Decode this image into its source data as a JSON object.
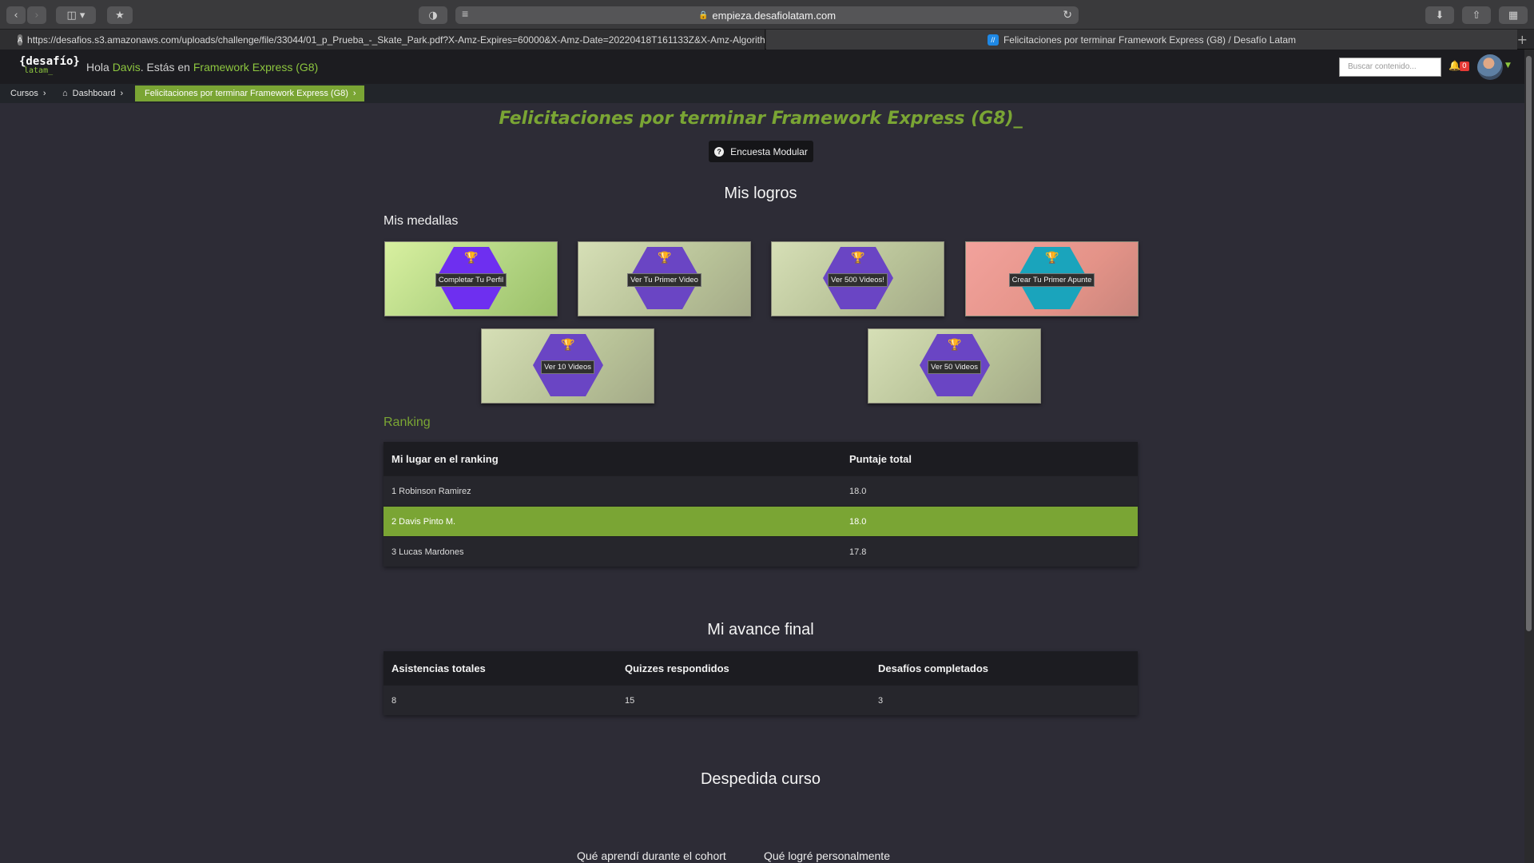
{
  "browser": {
    "url": "empieza.desafiolatam.com",
    "tabs": [
      {
        "label": "https://desafios.s3.amazonaws.com/uploads/challenge/file/33044/01_p_Prueba_-_Skate_Park.pdf?X-Amz-Expires=60000&X-Amz-Date=20220418T161133Z&X-Amz-Algorith...",
        "favicon": "A"
      },
      {
        "label": "Felicitaciones por terminar Framework Express (G8) / Desafío Latam",
        "favicon": "//"
      }
    ]
  },
  "header": {
    "logo_top": "{desafío}",
    "logo_bottom": "latam_",
    "greeting_prefix": "Hola",
    "user_name": "Davis",
    "greeting_middle": ". Estás en",
    "course_name": "Framework Express (G8)",
    "search_placeholder": "Buscar contenido...",
    "notification_count": "0"
  },
  "breadcrumb": [
    {
      "label": "Cursos"
    },
    {
      "label": "Dashboard"
    },
    {
      "label": "Felicitaciones por terminar Framework Express (G8)"
    }
  ],
  "main": {
    "title": "Felicitaciones por terminar Framework Express (G8)_",
    "survey_button": "Encuesta Modular",
    "achievements_title": "Mis logros",
    "medals_heading": "Mis medallas",
    "medals": [
      {
        "label": "Completar Tu Perfil",
        "color": "#6e2ff0"
      },
      {
        "label": "Ver Tu Primer Video",
        "color": "#6a45c4"
      },
      {
        "label": "Ver 500 Videos!",
        "color": "#6a45c4"
      },
      {
        "label": "Crear Tu Primer Apunte",
        "color": "#1aa4bc"
      },
      {
        "label": "Ver 10 Videos",
        "color": "#6a45c4"
      },
      {
        "label": "Ver 50 Videos",
        "color": "#6a45c4"
      }
    ],
    "ranking_heading": "Ranking",
    "ranking": {
      "headers": [
        "Mi lugar en el ranking",
        "Puntaje total"
      ],
      "rows": [
        {
          "place": "1 Robinson Ramirez",
          "score": "18.0"
        },
        {
          "place": "2 Davis Pinto M.",
          "score": "18.0"
        },
        {
          "place": "3 Lucas Mardones",
          "score": "17.8"
        }
      ]
    },
    "progress_title": "Mi avance final",
    "progress": {
      "headers": [
        "Asistencias totales",
        "Quizzes respondidos",
        "Desafíos completados"
      ],
      "values": [
        "8",
        "15",
        "3"
      ]
    },
    "farewell_title": "Despedida curso",
    "farewell_links": [
      "Qué aprendí durante el cohort",
      "Qué logré personalmente"
    ]
  },
  "colors": {
    "accent": "#7aa534",
    "background": "#2d2c36"
  }
}
